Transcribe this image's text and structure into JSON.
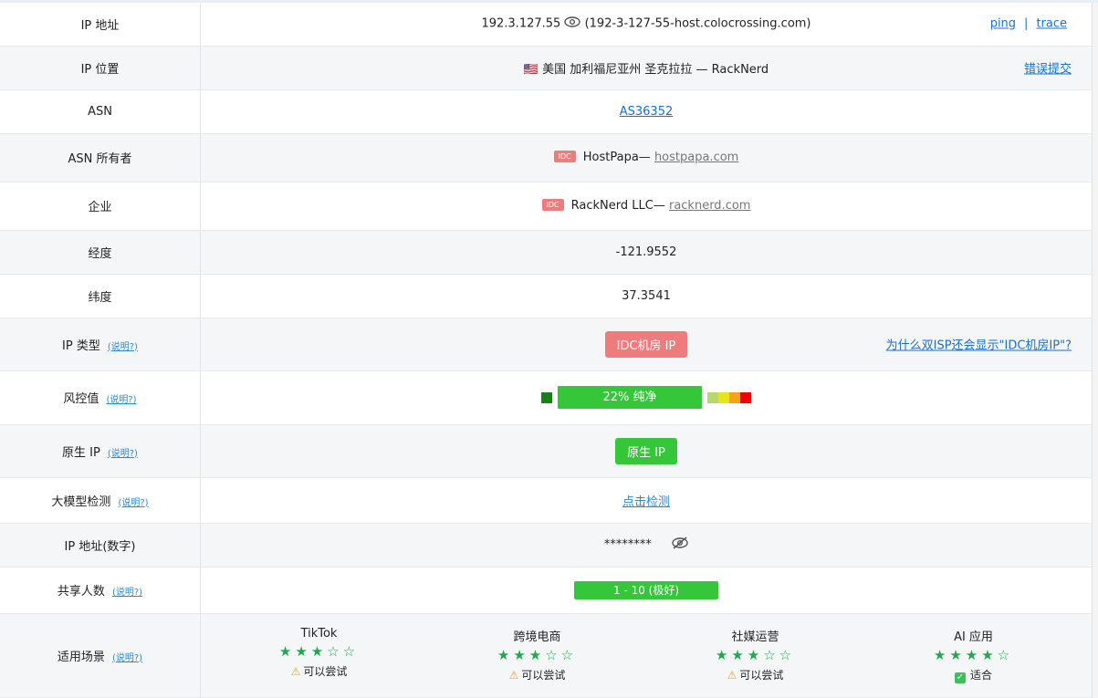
{
  "rows": {
    "ip": {
      "label": "IP 地址",
      "value": "192.3.127.55",
      "host": "(192-3-127-55-host.colocrossing.com)",
      "ping": "ping",
      "sep": "|",
      "trace": "trace"
    },
    "location": {
      "label": "IP 位置",
      "flag": "🇺🇸",
      "value": "美国 加利福尼亚州 圣克拉拉 — RackNerd",
      "report": "错误提交"
    },
    "asn": {
      "label": "ASN",
      "value": "AS36352"
    },
    "asn_owner": {
      "label": "ASN 所有者",
      "badge": "IDC",
      "name": "HostPapa—",
      "domain": "hostpapa.com"
    },
    "company": {
      "label": "企业",
      "badge": "IDC",
      "name": "RackNerd LLC—",
      "domain": "racknerd.com"
    },
    "longitude": {
      "label": "经度",
      "value": "-121.9552"
    },
    "latitude": {
      "label": "纬度",
      "value": "37.3541"
    },
    "ip_type": {
      "label": "IP 类型",
      "hint": "(说明?)",
      "value": "IDC机房 IP",
      "side": "为什么双ISP还会显示\"IDC机房IP\"?"
    },
    "risk": {
      "label": "风控值",
      "hint": "(说明?)",
      "value": "22%  纯净",
      "percent": 22,
      "scale_colors": [
        "#b5d96a",
        "#e5e51a",
        "#f7a21b",
        "#f00000"
      ]
    },
    "native": {
      "label": "原生 IP",
      "hint": "(说明?)",
      "value": "原生 IP"
    },
    "llm": {
      "label": "大模型检测",
      "hint": "(说明?)",
      "value": "点击检测"
    },
    "numeric": {
      "label": "IP 地址(数字)",
      "value": "********"
    },
    "shared": {
      "label": "共享人数",
      "hint": "(说明?)",
      "value": "1 - 10 (极好)"
    },
    "scenes": {
      "label": "适用场景",
      "hint": "(说明?)",
      "items": [
        {
          "name": "TikTok",
          "rating": 3,
          "stars": "★★★☆☆",
          "verdict": "可以尝试",
          "icon": "warning-icon"
        },
        {
          "name": "跨境电商",
          "rating": 3,
          "stars": "★★★☆☆",
          "verdict": "可以尝试",
          "icon": "warning-icon"
        },
        {
          "name": "社媒运营",
          "rating": 3,
          "stars": "★★★☆☆",
          "verdict": "可以尝试",
          "icon": "warning-icon"
        },
        {
          "name": "AI 应用",
          "rating": 4,
          "stars": "★★★★☆",
          "verdict": "适合",
          "icon": "check-icon"
        }
      ]
    }
  },
  "colors": {
    "green": "#35c63a",
    "red_badge": "#ee7c7c",
    "link": "#1a6fd1",
    "star": "#22a74c"
  }
}
